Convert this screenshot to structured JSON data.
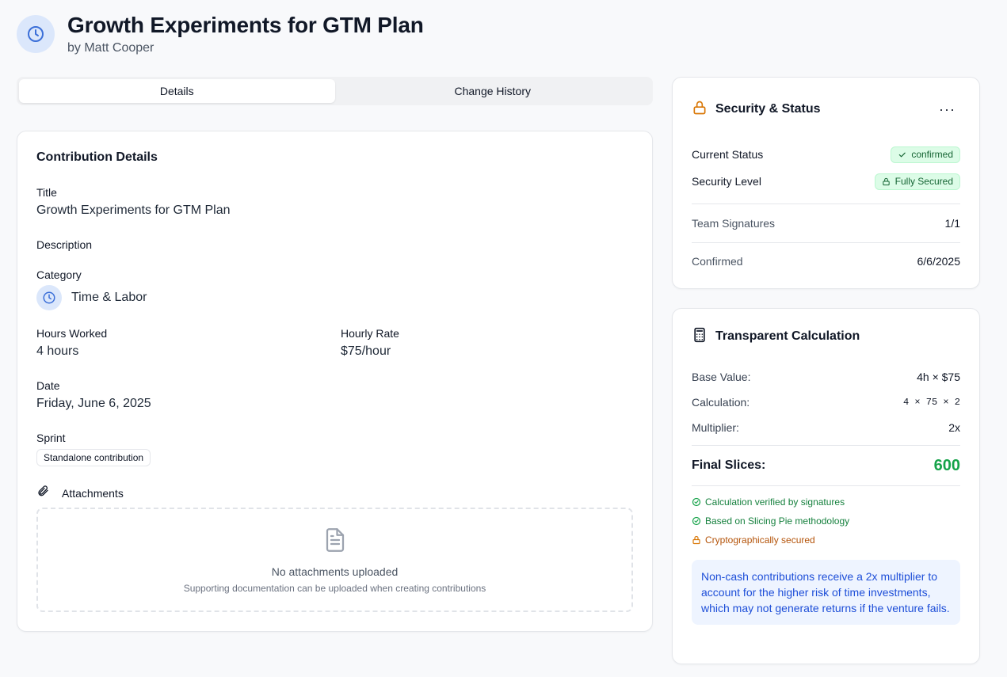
{
  "header": {
    "title": "Growth Experiments for GTM Plan",
    "subtitle": "by Matt Cooper",
    "icon": "clock-icon"
  },
  "tabs": [
    {
      "label": "Details",
      "active": true
    },
    {
      "label": "Change History",
      "active": false
    }
  ],
  "details": {
    "heading": "Contribution Details",
    "title_label": "Title",
    "title_value": "Growth Experiments for GTM Plan",
    "description_label": "Description",
    "category_label": "Category",
    "category_value": "Time & Labor",
    "hours_label": "Hours Worked",
    "hours_value": "4 hours",
    "rate_label": "Hourly Rate",
    "rate_value": "$75/hour",
    "date_label": "Date",
    "date_value": "Friday, June 6, 2025",
    "sprint_label": "Sprint",
    "sprint_value": "Standalone contribution",
    "attachments_label": "Attachments",
    "no_attachments": "No attachments uploaded",
    "attachments_hint": "Supporting documentation can be uploaded when creating contributions"
  },
  "security": {
    "title": "Security & Status",
    "more": "···",
    "status_label": "Current Status",
    "status_value": "confirmed",
    "level_label": "Security Level",
    "level_value": "Fully Secured",
    "signatures_label": "Team Signatures",
    "signatures_value": "1/1",
    "confirmed_label": "Confirmed",
    "confirmed_value": "6/6/2025"
  },
  "calculation": {
    "title": "Transparent Calculation",
    "base_label": "Base Value:",
    "base_value": "4h × $75",
    "calc_label": "Calculation:",
    "calc_value": "4 × 75 × 2",
    "mult_label": "Multiplier:",
    "mult_value": "2x",
    "final_label": "Final Slices:",
    "final_value": "600",
    "checks": [
      "Calculation verified by signatures",
      "Based on Slicing Pie methodology",
      "Cryptographically secured"
    ],
    "note": "Non-cash contributions receive a 2x multiplier to account for the higher risk of time investments, which may not generate returns if the venture fails."
  },
  "colors": {
    "accent_blue": "#3b6fd8",
    "success_green": "#16a34a",
    "lock_orange": "#d97706"
  }
}
